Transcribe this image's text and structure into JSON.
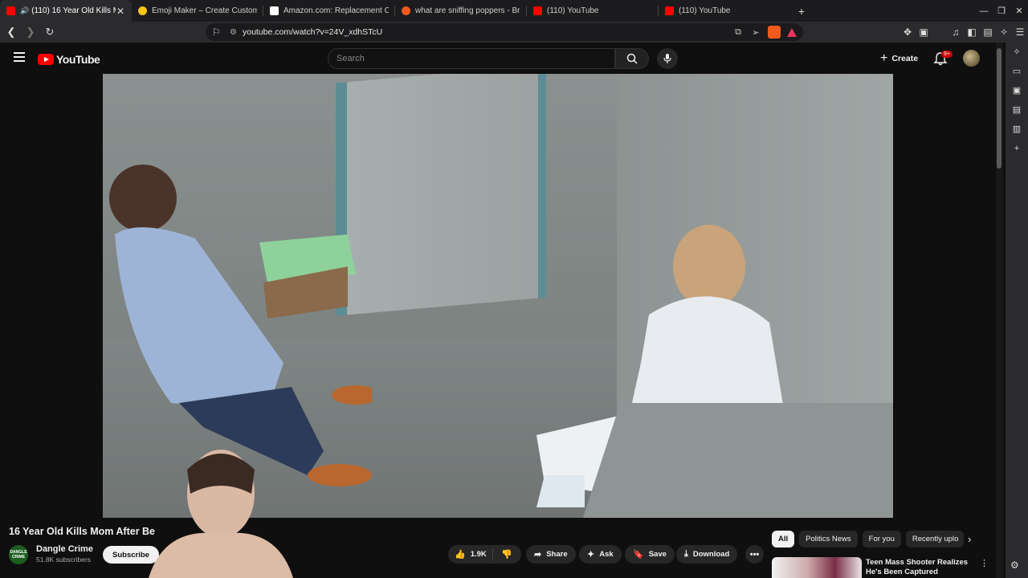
{
  "tabs": [
    {
      "title": "(110) 16 Year Old Kills Mo",
      "favicon_color": "#ff0000",
      "active": true
    },
    {
      "title": "Emoji Maker – Create Custom &",
      "favicon_color": "#f5c518",
      "active": false
    },
    {
      "title": "Amazon.com: Replacement CPU",
      "favicon_color": "#ffffff",
      "active": false
    },
    {
      "title": "what are sniffing poppers - Brav",
      "favicon_color": "#f25a1d",
      "active": false
    },
    {
      "title": "(110) YouTube",
      "favicon_color": "#ff0000",
      "active": false
    },
    {
      "title": "(110) YouTube",
      "favicon_color": "#ff0000",
      "active": false
    }
  ],
  "address": {
    "url": "youtube.com/watch?v=24V_xdhSTcU"
  },
  "header": {
    "logo": "YouTube",
    "search_placeholder": "Search",
    "create_label": "Create",
    "notif_badge": "9+"
  },
  "video": {
    "title": "16 Year Old Kills Mom After Be",
    "channel": "Dangle Crime",
    "channel_avatar_text": "DANGLE CRIME",
    "subscribers": "51.8K subscribers",
    "subscribe_label": "Subscribe",
    "likes": "1.9K",
    "share_label": "Share",
    "ask_label": "Ask",
    "save_label": "Save",
    "download_label": "Download"
  },
  "chips": [
    "All",
    "Politics News",
    "For you",
    "Recently uplo"
  ],
  "recommendation": {
    "title": "Teen Mass Shooter Realizes He's Been Captured"
  },
  "colors": {
    "accent": "#ff0000",
    "background": "#0f0f0f",
    "pill": "#272727"
  }
}
